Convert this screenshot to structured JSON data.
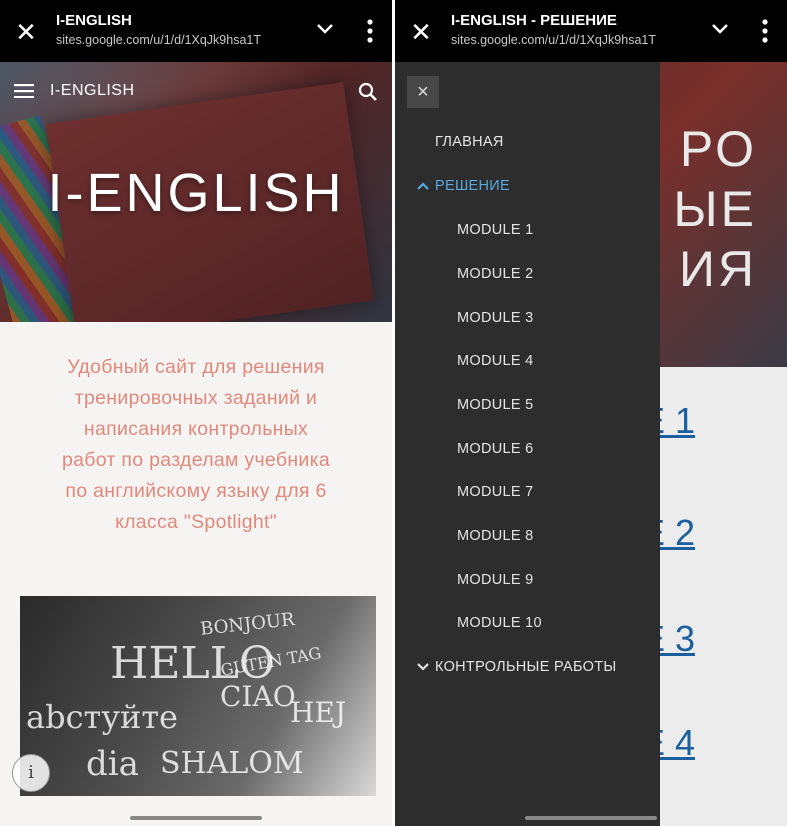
{
  "left": {
    "chrome": {
      "title": "I-ENGLISH",
      "url": "sites.google.com/u/1/d/1XqJk9hsa1T"
    },
    "header": {
      "site_name": "I-ENGLISH",
      "hero_title": "I-ENGLISH"
    },
    "intro_lines": [
      "Удобный сайт для решения",
      "тренировочных заданий и",
      "написания контрольных",
      "работ по разделам учебника",
      "по английскому языку для 6",
      "класса \"Spotlight\""
    ],
    "chalk_words": [
      "BONJOUR",
      "HELLO",
      "GUTEN TAG",
      "CIAO",
      "HEJ",
      "abcтуйте",
      "dia",
      "SHALOM"
    ],
    "info_icon": "i"
  },
  "right": {
    "chrome": {
      "title": "I-ENGLISH - РЕШЕНИЕ",
      "url": "sites.google.com/u/1/d/1XqJk9hsa1T"
    },
    "background": {
      "hero_lines": [
        "РО",
        "ЫЕ",
        "ИЯ"
      ],
      "links": [
        "Е 1",
        "Е 2",
        "Е 3",
        "Е 4"
      ]
    },
    "drawer": {
      "close_icon": "×",
      "home": "ГЛАВНАЯ",
      "section": "РЕШЕНИЕ",
      "modules": [
        "MODULE 1",
        "MODULE 2",
        "MODULE 3",
        "MODULE 4",
        "MODULE 5",
        "MODULE 6",
        "MODULE 7",
        "MODULE 8",
        "MODULE 9",
        "MODULE 10"
      ],
      "collapsed_section": "КОНТРОЛЬНЫЕ РАБОТЫ"
    }
  },
  "colors": {
    "intro_text": "#e0897b",
    "drawer_bg": "#2d2d2d",
    "drawer_active": "#58a9e0",
    "link": "#1b5fa0"
  }
}
